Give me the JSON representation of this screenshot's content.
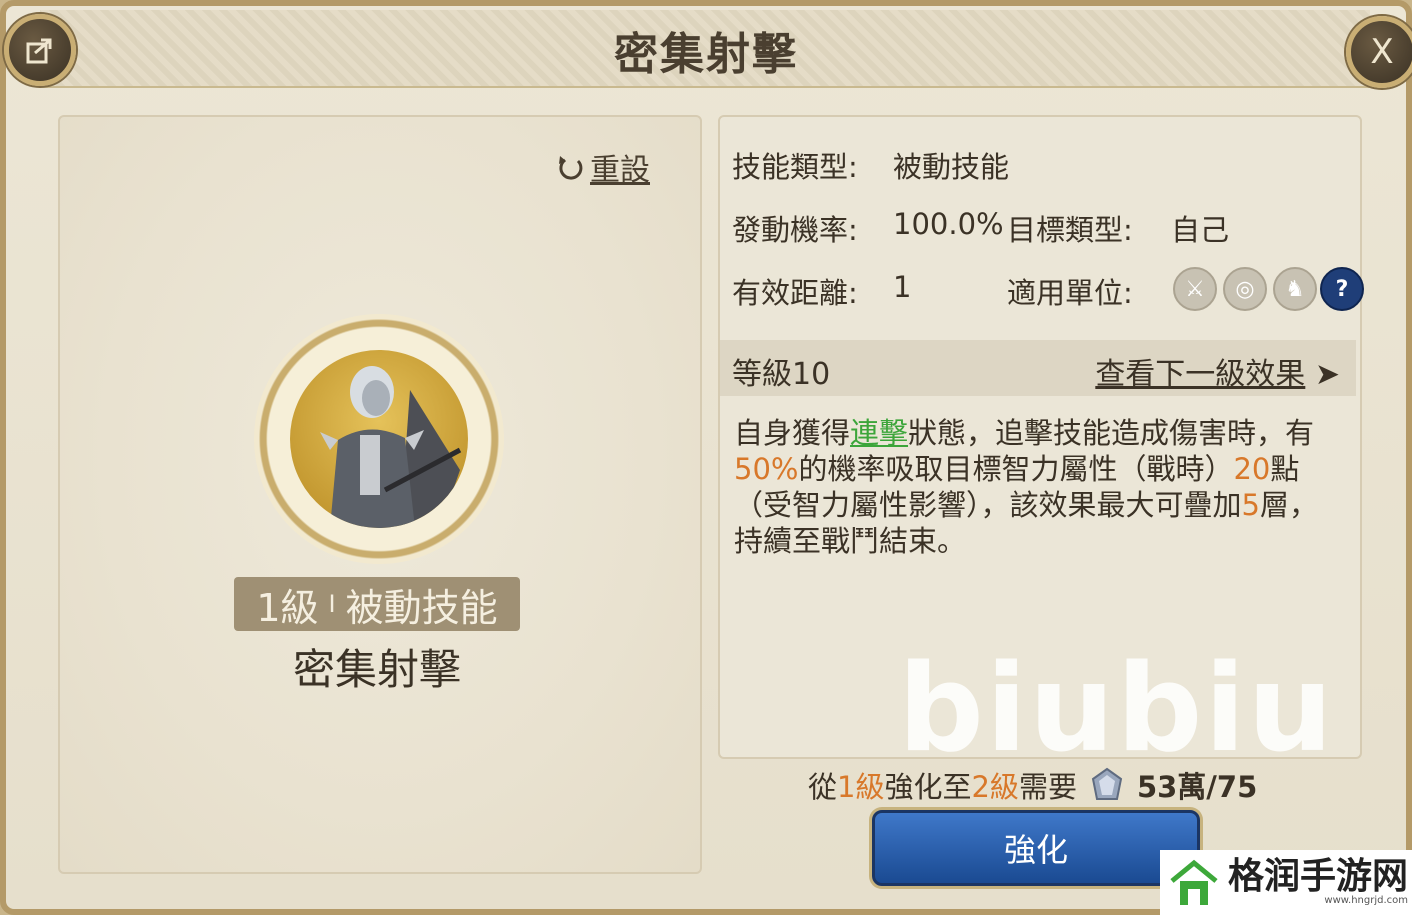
{
  "window": {
    "title": "密集射擊"
  },
  "buttons": {
    "share": "share",
    "close": "X",
    "reset": "重設",
    "enhance": "強化"
  },
  "skill": {
    "level_label": "1級",
    "separator": "I",
    "type_label": "被動技能",
    "name": "密集射擊"
  },
  "info": {
    "skill_type_label": "技能類型:",
    "skill_type_value": "被動技能",
    "trigger_rate_label": "發動機率:",
    "trigger_rate_value": "100.0%",
    "target_type_label": "目標類型:",
    "target_type_value": "自己",
    "range_label": "有效距離:",
    "range_value": "1",
    "units_label": "適用單位:",
    "unit_icons": [
      "sword-icon",
      "target-icon",
      "horse-icon",
      "question-icon"
    ]
  },
  "level_bar": {
    "level": "等級10",
    "next_level": "查看下一級效果",
    "arrow": "➤"
  },
  "description": {
    "p1": "自身獲得",
    "link": "連擊",
    "p2": "狀態，追擊技能造成傷害時，有",
    "rate": "50%",
    "p3": "的機率吸取目標智力屬性（戰時）",
    "amount": "20",
    "p4": "點（受智力屬性影響），該效果最大可疊加",
    "stacks": "5",
    "p5": "層，持續至戰鬥結束。"
  },
  "cost": {
    "prefix": "從",
    "from_level": "1級",
    "mid": "強化至",
    "to_level": "2級",
    "suffix": "需要",
    "amount": "53萬/75"
  },
  "watermark": "biubiu",
  "brand": {
    "name": "格润手游网",
    "url": "www.hngrjd.com"
  },
  "colors": {
    "accent_green": "#3ca53a",
    "accent_orange": "#d8782a",
    "button_blue": "#2a5fae",
    "frame_gold": "#b49a68"
  }
}
